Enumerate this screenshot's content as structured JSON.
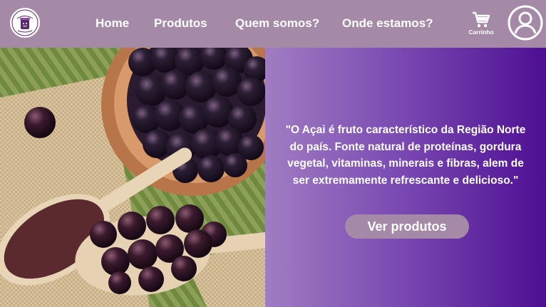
{
  "header": {
    "logo_icon": "acai-cup-logo-icon",
    "nav": [
      "Home",
      "Produtos",
      "Quem somos?",
      "Onde estamos?"
    ],
    "cart_label": "Carrinho",
    "cart_icon": "shopping-cart-icon",
    "account_icon": "user-account-icon"
  },
  "hero": {
    "image": "acai-berries-bowl-spoons-photo",
    "quote": "\"O Açai é fruto característico da Região Norte do país. Fonte natural de proteínas, gordura vegetal, vitaminas, minerais e fibras, alem de ser extremamente refrescante e delicioso.\"",
    "cta_label": "Ver produtos"
  },
  "colors": {
    "navbar": "#a58aa8",
    "panel_gradient_start": "#a07dc2",
    "panel_gradient_end": "#4e0f93",
    "button": "#a58aa8",
    "text": "#ffffff"
  }
}
